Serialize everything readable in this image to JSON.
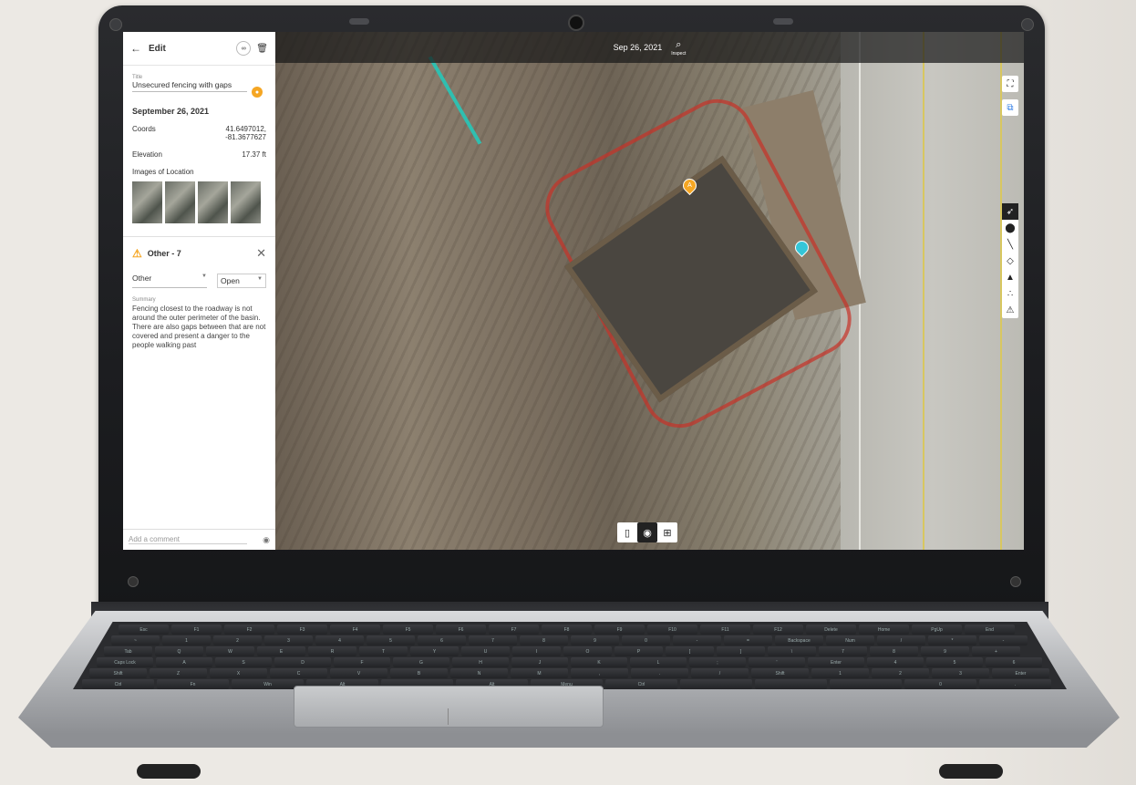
{
  "topbar": {
    "date": "Sep 26, 2021",
    "inspect_label": "Inspect"
  },
  "panel": {
    "header_title": "Edit",
    "title_label": "Title",
    "title_value": "Unsecured fencing with gaps",
    "date_heading": "September 26, 2021",
    "coords_label": "Coords",
    "coords_lat": "41.6497012,",
    "coords_lon": "-81.3677627",
    "elevation_label": "Elevation",
    "elevation_value": "17.37 ft",
    "images_label": "Images of Location",
    "issue_title": "Other - 7",
    "category_value": "Other",
    "status_value": "Open",
    "summary_label": "Summary",
    "summary_text": "Fencing closest to the roadway is not around the outer perimeter of the basin. There are also gaps between that are not covered and present a danger to the people walking past",
    "comment_placeholder": "Add a comment"
  },
  "pins": {
    "a_label": "A"
  },
  "tools": [
    "cursor-icon",
    "pin-icon",
    "line-icon",
    "polygon-icon",
    "cone-icon",
    "points-icon",
    "warning-icon"
  ],
  "view_modes": [
    "map-view-icon",
    "pin-view-icon",
    "split-view-icon"
  ],
  "colors": {
    "accent": "#2c7be5",
    "warning": "#f5a623",
    "pin_cyan": "#34c6d8",
    "fence_red": "#c83228"
  },
  "keyboard": {
    "rows": [
      [
        "Esc",
        "F1",
        "F2",
        "F3",
        "F4",
        "F5",
        "F6",
        "F7",
        "F8",
        "F9",
        "F10",
        "F11",
        "F12",
        "Delete",
        "Home",
        "PgUp",
        "End"
      ],
      [
        "~",
        "1",
        "2",
        "3",
        "4",
        "5",
        "6",
        "7",
        "8",
        "9",
        "0",
        "-",
        "=",
        "Backspace",
        "Num",
        "/",
        "*",
        "-"
      ],
      [
        "Tab",
        "Q",
        "W",
        "E",
        "R",
        "T",
        "Y",
        "U",
        "I",
        "O",
        "P",
        "[",
        "]",
        "\\",
        "7",
        "8",
        "9",
        "+"
      ],
      [
        "Caps Lock",
        "A",
        "S",
        "D",
        "F",
        "G",
        "H",
        "J",
        "K",
        "L",
        ";",
        "'",
        "Enter",
        "4",
        "5",
        "6"
      ],
      [
        "Shift",
        "Z",
        "X",
        "C",
        "V",
        "B",
        "N",
        "M",
        ",",
        ".",
        "/",
        "Shift",
        "1",
        "2",
        "3",
        "Enter"
      ],
      [
        "Ctrl",
        "Fn",
        "Win",
        "Alt",
        "",
        "Alt",
        "Menu",
        "Ctrl",
        "",
        "",
        "",
        "0",
        "."
      ]
    ]
  }
}
